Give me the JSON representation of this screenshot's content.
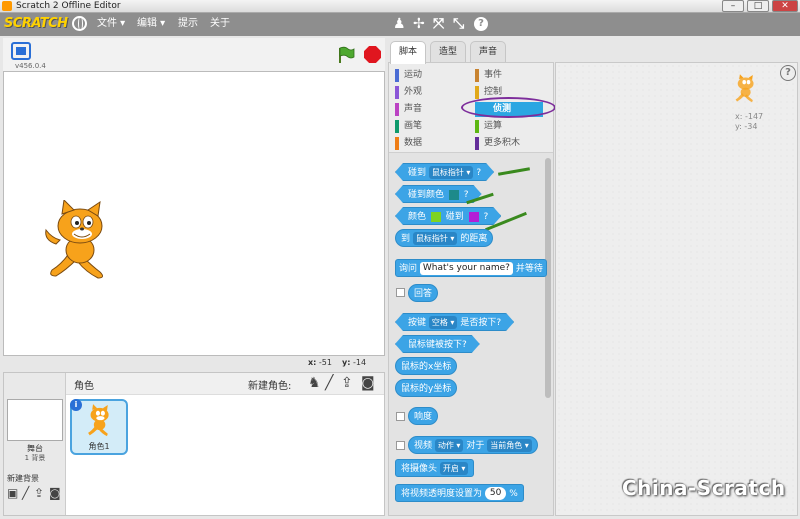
{
  "window": {
    "title": "Scratch 2 Offline Editor",
    "min": "–",
    "max": "□",
    "close": "✕"
  },
  "menubar": {
    "logo": "SCRATCH",
    "items": [
      "文件",
      "编辑",
      "提示",
      "关于"
    ]
  },
  "stage": {
    "version": "v456.0.4",
    "mouse_x_label": "x:",
    "mouse_x": "-51",
    "mouse_y_label": "y:",
    "mouse_y": "-14"
  },
  "sprites_pane": {
    "title": "角色",
    "new_sprite_label": "新建角色:",
    "stage_label": "舞台",
    "stage_backdrops": "1 背景",
    "new_backdrop_label": "新建背景",
    "sprite_name": "角色1",
    "info": "i"
  },
  "tabs": [
    "脚本",
    "造型",
    "声音"
  ],
  "categories": {
    "left": [
      {
        "label": "运动",
        "color": "#4a6cd4"
      },
      {
        "label": "外观",
        "color": "#8a55d7"
      },
      {
        "label": "声音",
        "color": "#bb42c3"
      },
      {
        "label": "画笔",
        "color": "#0e9a6c"
      },
      {
        "label": "数据",
        "color": "#ee7d16"
      }
    ],
    "right": [
      {
        "label": "事件",
        "color": "#c88330"
      },
      {
        "label": "控制",
        "color": "#e1a91a"
      },
      {
        "label": "侦测",
        "color": "#2ca5e2"
      },
      {
        "label": "运算",
        "color": "#5cb712"
      },
      {
        "label": "更多积木",
        "color": "#632d99"
      }
    ]
  },
  "blocks": {
    "touching": {
      "prefix": "碰到",
      "dropdown": "鼠标指针",
      "suffix": "?"
    },
    "touching_color": {
      "prefix": "碰到颜色",
      "suffix": "?",
      "color": "#1d8a8a"
    },
    "color_touching": {
      "prefix": "颜色",
      "mid": "碰到",
      "suffix": "?",
      "color1": "#7ed321",
      "color2": "#b21fd6"
    },
    "distance": {
      "prefix": "到",
      "dropdown": "鼠标指针",
      "suffix": "的距离"
    },
    "ask": {
      "prefix": "询问",
      "input": "What's your name?",
      "suffix": "并等待"
    },
    "answer": "回答",
    "key_pressed": {
      "prefix": "按键",
      "dropdown": "空格",
      "suffix": "是否按下?"
    },
    "mouse_down": "鼠标键被按下?",
    "mouse_x": "鼠标的x坐标",
    "mouse_y": "鼠标的y坐标",
    "loudness": "响度",
    "video": {
      "prefix": "视频",
      "dropdown1": "动作",
      "mid": "对于",
      "dropdown2": "当前角色"
    },
    "turn_video": {
      "prefix": "将摄像头",
      "dropdown": "开启"
    },
    "transparency": {
      "prefix": "将视频透明度设置为",
      "value": "50",
      "suffix": "%"
    }
  },
  "scripts_area": {
    "x_label": "x:",
    "x": "-147",
    "y_label": "y:",
    "y": "-34",
    "help": "?"
  },
  "watermark": "China-Scratch"
}
